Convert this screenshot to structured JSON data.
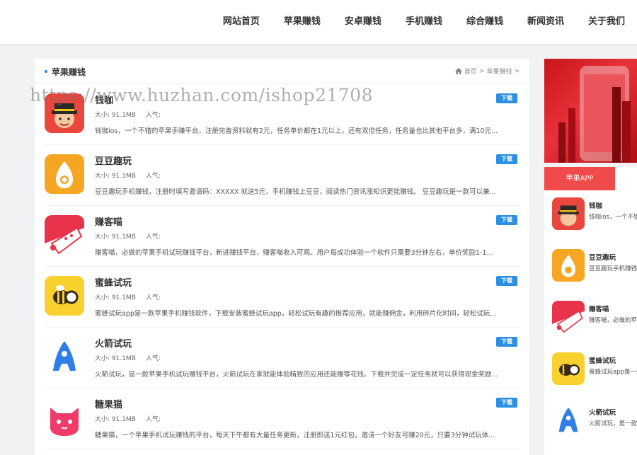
{
  "nav": [
    "网站首页",
    "苹果赚钱",
    "安卓赚钱",
    "手机赚钱",
    "综合赚钱",
    "新闻资讯",
    "关于我们"
  ],
  "section": {
    "title": "苹果赚钱",
    "breadcrumb": [
      "首页",
      ">",
      "苹果赚钱",
      ">"
    ]
  },
  "watermark": "https://www.huzhan.com/ishop21708",
  "items": [
    {
      "name": "钱咖",
      "size": "大小: 91.1MB",
      "pop": "人气:",
      "download": "下载",
      "icon": "qianka-icon",
      "desc": "钱咖ios，一个不错的苹果手赚平台，注册完善资料就有2元，任务单价都在1元以上，还有双倍任务，任务量也比其他平台多，满10元..."
    },
    {
      "name": "豆豆趣玩",
      "size": "大小: 91.1MB",
      "pop": "人气:",
      "download": "下载",
      "icon": "doudou-icon",
      "desc": "豆豆趣玩手机赚钱，注册时填写邀请码：XXXXX 就送5元，手机赚钱上豆豆，阅读热门资讯涨知识更能赚钱。 豆豆趣玩是一款可以兼..."
    },
    {
      "name": "赚客喵",
      "size": "大小: 91.1MB",
      "pop": "人气:",
      "download": "下载",
      "icon": "zhuankemiao-icon",
      "desc": "赚客喵，必做的苹果手机试玩赚钱平台，新进赚钱平台，赚客喵收入可观。用户每成功体验一个软件只需要3分钟左右，单价奖励1-1..."
    },
    {
      "name": "蜜蜂试玩",
      "size": "大小: 91.1MB",
      "pop": "人气:",
      "download": "下载",
      "icon": "mifeng-icon",
      "desc": "蜜蜂试玩app是一款苹果手机赚钱软件，下载安装蜜蜂试玩app，轻松试玩有趣的推荐应用，就能赚佣金，利用碎片化时间，轻松试玩..."
    },
    {
      "name": "火箭试玩",
      "size": "大小: 91.1MB",
      "pop": "人气:",
      "download": "下载",
      "icon": "huojian-icon",
      "desc": "火箭试玩，是一款苹果手机试玩赚钱平台，火箭试玩在家就能体验精致的应用还能赚零花钱。下载并完成一定任务就可以获得现金奖励..."
    },
    {
      "name": "糖果猫",
      "size": "大小: 91.1MB",
      "pop": "人气:",
      "download": "下载",
      "icon": "tangguomao-icon",
      "desc": "糖果猫，一个苹果手机试玩赚钱的平台，每天下午都有大量任务更新，注册即送1元红包，邀请一个好友可赚20元，只要3分钟试玩体..."
    }
  ],
  "sidebar": {
    "tab": "苹果APP",
    "items": [
      {
        "name": "钱咖",
        "desc": "钱咖ios，一个不错",
        "icon": "qianka-icon"
      },
      {
        "name": "豆豆趣玩",
        "desc": "豆豆趣玩手机赚钱",
        "icon": "doudou-icon"
      },
      {
        "name": "赚客喵",
        "desc": "赚客喵，必做的苹",
        "icon": "zhuankemiao-icon"
      },
      {
        "name": "蜜蜂试玩",
        "desc": "蜜蜂试玩app是一款",
        "icon": "mifeng-icon"
      },
      {
        "name": "火箭试玩",
        "desc": "火箭试玩，是一款",
        "icon": "huojian-icon"
      }
    ]
  }
}
